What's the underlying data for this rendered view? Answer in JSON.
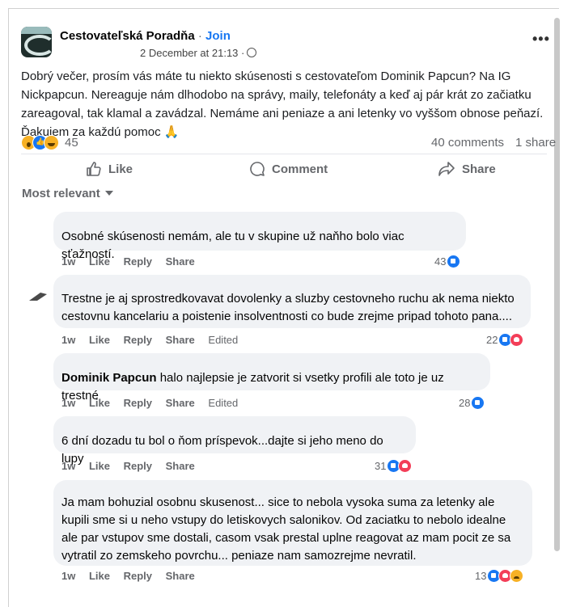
{
  "post": {
    "group_name": "Cestovateľská Poradňa",
    "separator": "·",
    "join_label": "Join",
    "timestamp": "2 December at 21:13 ·",
    "more_label": "•••",
    "text": "Dobrý večer, prosím vás máte tu niekto skúsenosti s cestovateľom Dominik Papcun? Na IG Nickpapcun. Nereaguje nám dlhodobo na správy, maily, telefonáty a keď aj pár krát zo začiatku zareagoval, tak klamal a zavádzal. Nemáme ani peniaze a ani letenky vo vyššom obnose peňazí. Ďakujem za každú pomoc 🙏",
    "reaction_count": "45",
    "reaction_icons": [
      "wow-icon",
      "like-icon",
      "haha-icon"
    ],
    "comments_count": "40 comments",
    "shares_count": "1 share"
  },
  "actions": {
    "like": "Like",
    "comment": "Comment",
    "share": "Share"
  },
  "sort_label": "Most relevant",
  "comment_actions": {
    "like": "Like",
    "reply": "Reply",
    "share": "Share",
    "edited": "Edited"
  },
  "comments": [
    {
      "author": "",
      "text": "Osobné skúsenosti nemám, ale tu v skupine už naňho bolo viac sťažností.",
      "age": "1w",
      "reactions": "43",
      "reaction_types": [
        "like"
      ],
      "edited": false
    },
    {
      "author": "",
      "text": "Trestne je aj sprostredkovavat dovolenky a sluzby cestovneho ruchu ak nema niekto cestovnu kancelariu a poistenie insolventnosti co bude zrejme pripad tohoto pana....",
      "age": "1w",
      "reactions": "22",
      "reaction_types": [
        "like",
        "love"
      ],
      "edited": true
    },
    {
      "author": "",
      "mention": "Dominik Papcun",
      "text": " halo najlepsie je zatvorit si vsetky profili ale toto je uz trestné",
      "age": "1w",
      "reactions": "28",
      "reaction_types": [
        "like"
      ],
      "edited": true
    },
    {
      "author": "",
      "text": "6 dní dozadu tu bol o ňom príspevok...dajte si jeho meno do lupy",
      "age": "1w",
      "reactions": "31",
      "reaction_types": [
        "like",
        "love"
      ],
      "edited": false
    },
    {
      "author": "",
      "text": "Ja mam bohuzial osobnu skusenost... sice to nebola vysoka suma za letenky ale kupili sme si u neho vstupy do letiskovych salonikov. Od zaciatku to nebolo idealne ale par vstupov sme dostali, casom vsak prestal uplne reagovat az mam pocit ze sa vytratil zo zemskeho povrchu... peniaze nam samozrejme nevratil.",
      "age": "1w",
      "reactions": "13",
      "reaction_types": [
        "like",
        "love",
        "sad"
      ],
      "edited": false
    }
  ]
}
